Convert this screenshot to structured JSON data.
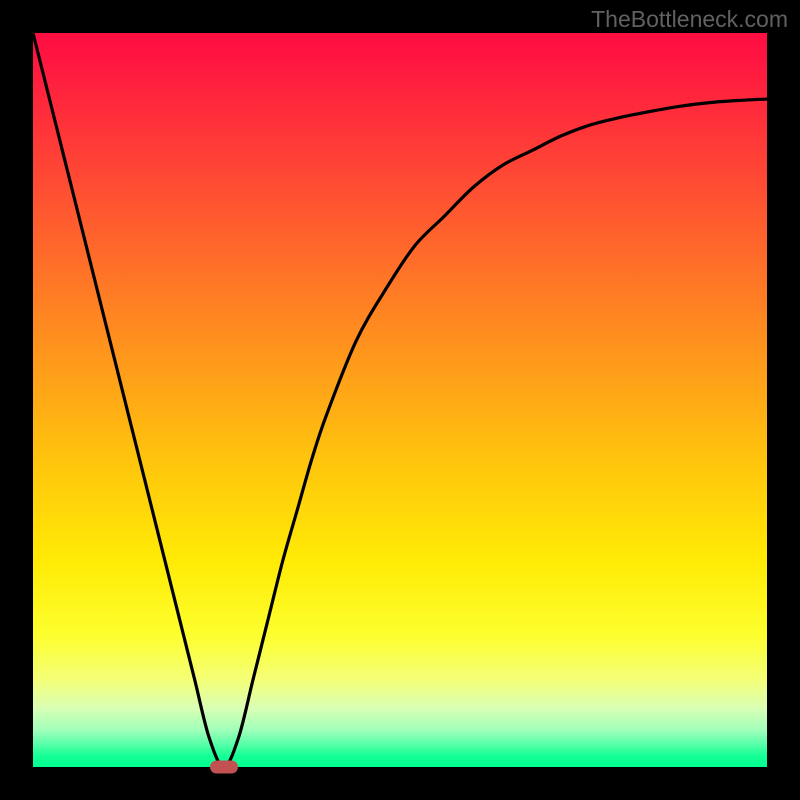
{
  "watermark": "TheBottleneck.com",
  "colors": {
    "page_bg": "#000000",
    "curve": "#000000",
    "marker": "#c15251"
  },
  "chart_data": {
    "type": "line",
    "title": "",
    "xlabel": "",
    "ylabel": "",
    "xlim": [
      0,
      100
    ],
    "ylim": [
      0,
      100
    ],
    "grid": false,
    "legend": false,
    "series": [
      {
        "name": "bottleneck-curve",
        "x": [
          0,
          2,
          4,
          6,
          8,
          10,
          12,
          14,
          16,
          18,
          20,
          22,
          24,
          26,
          28,
          30,
          32,
          34,
          36,
          38,
          40,
          44,
          48,
          52,
          56,
          60,
          64,
          68,
          72,
          76,
          80,
          84,
          88,
          92,
          96,
          100
        ],
        "y": [
          100,
          92,
          84,
          76,
          68,
          60,
          52,
          44,
          36,
          28,
          20,
          12,
          4,
          0,
          4,
          12,
          20,
          28,
          35,
          42,
          48,
          58,
          65,
          71,
          75,
          79,
          82,
          84,
          86,
          87.5,
          88.5,
          89.3,
          90,
          90.5,
          90.8,
          91
        ]
      }
    ],
    "annotations": [
      {
        "type": "marker",
        "x": 26,
        "y": 0,
        "shape": "pill",
        "color": "#c15251"
      }
    ],
    "background_gradient": {
      "direction": "vertical",
      "stops": [
        {
          "pos": 0.0,
          "color": "#ff0d42"
        },
        {
          "pos": 0.4,
          "color": "#ff8a20"
        },
        {
          "pos": 0.72,
          "color": "#ffeb05"
        },
        {
          "pos": 0.92,
          "color": "#d9ffb5"
        },
        {
          "pos": 1.0,
          "color": "#00ff90"
        }
      ]
    }
  }
}
